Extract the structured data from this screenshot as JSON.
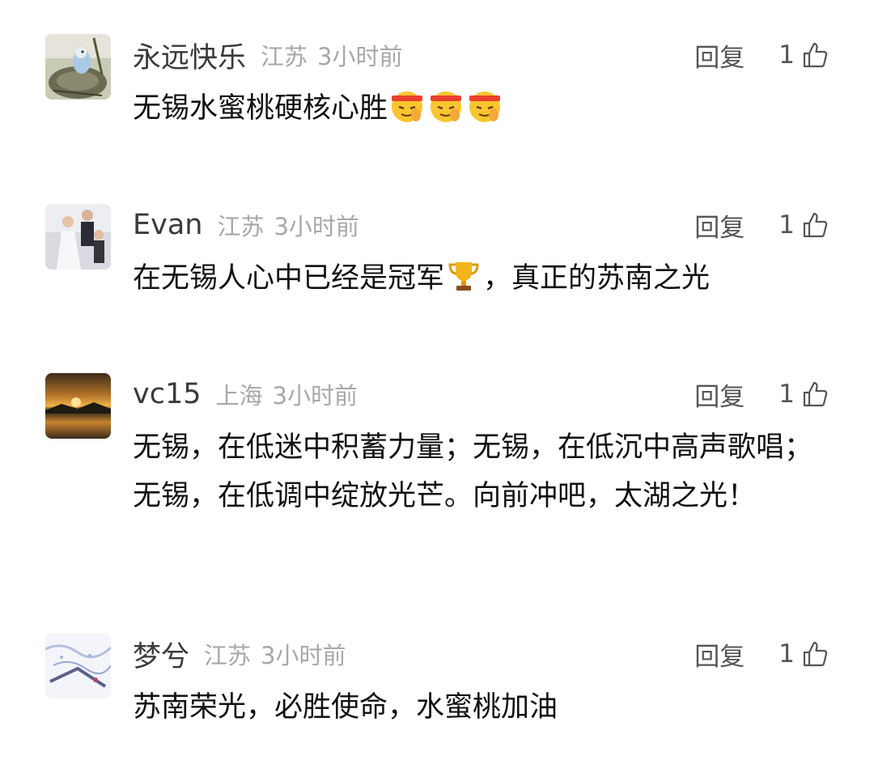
{
  "comments": [
    {
      "username": "永远快乐",
      "region": "江苏",
      "time": "3小时前",
      "reply_label": "回复",
      "likes": "1",
      "text": "无锡水蜜桃硬核心胜",
      "trailing_emojis": [
        "hush-fighting-emoji",
        "hush-fighting-emoji",
        "hush-fighting-emoji"
      ]
    },
    {
      "username": "Evan",
      "region": "江苏",
      "time": "3小时前",
      "reply_label": "回复",
      "likes": "1",
      "text_before": "在无锡人心中已经是冠军",
      "inline_emoji": "trophy-icon",
      "text_after": "，真正的苏南之光"
    },
    {
      "username": "vc15",
      "region": "上海",
      "time": "3小时前",
      "reply_label": "回复",
      "likes": "1",
      "text": "无锡，在低迷中积蓄力量；无锡，在低沉中高声歌唱；无锡，在低调中绽放光芒。向前冲吧，太湖之光！"
    },
    {
      "username": "梦兮",
      "region": "江苏",
      "time": "3小时前",
      "reply_label": "回复",
      "likes": "1",
      "text": "苏南荣光，必胜使命，水蜜桃加油"
    }
  ],
  "colors": {
    "username": "#3a3a3a",
    "meta": "#a8a8a8",
    "action": "#555555",
    "content": "#111111"
  },
  "icons": {
    "like": "thumbs-up-icon"
  }
}
